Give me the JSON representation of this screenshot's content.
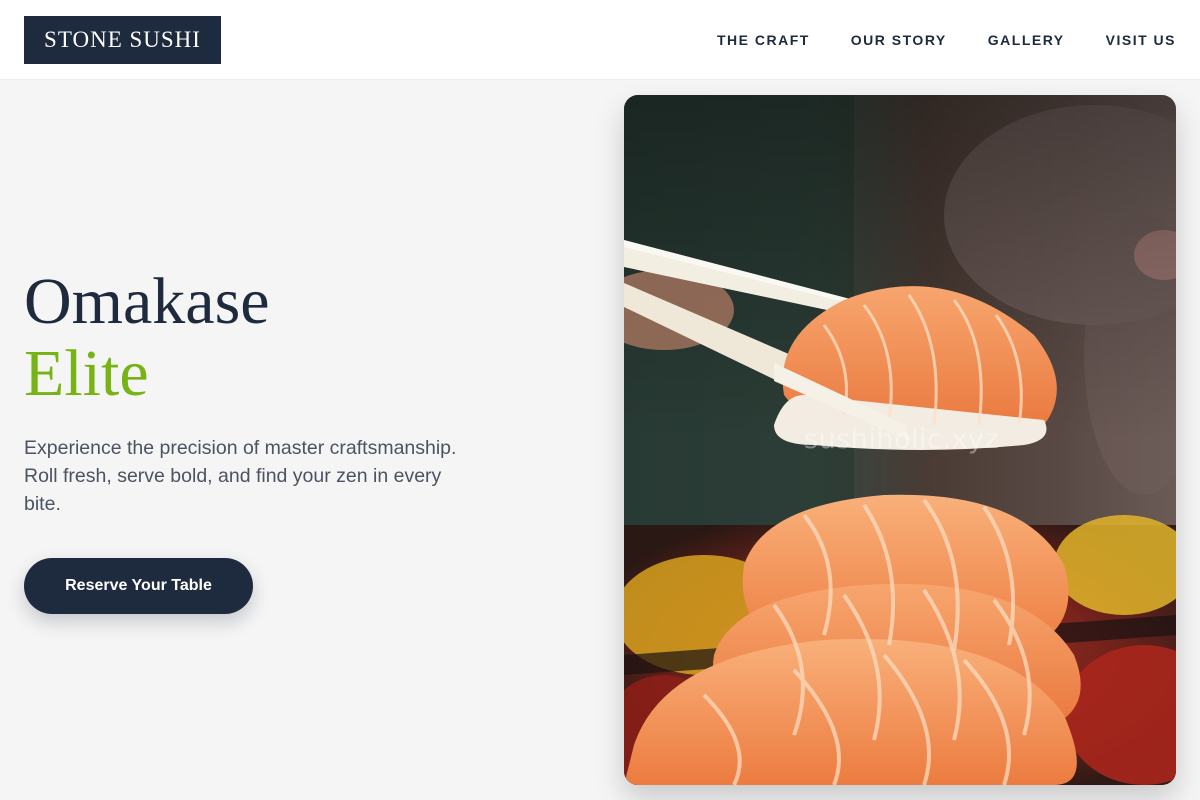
{
  "brand": {
    "name": "STONE SUSHI"
  },
  "nav": {
    "items": [
      {
        "label": "THE CRAFT"
      },
      {
        "label": "OUR STORY"
      },
      {
        "label": "GALLERY"
      },
      {
        "label": "VISIT US"
      }
    ]
  },
  "hero": {
    "title_line1": "Omakase",
    "title_line2": "Elite",
    "description": "Experience the precision of master craftsmanship. Roll fresh, serve bold, and find your zen in every bite.",
    "cta_label": "Reserve Your Table"
  },
  "image": {
    "subject": "salmon nigiri held by chopsticks above a platter of salmon sushi",
    "watermark": "sushiholic.xyz"
  },
  "colors": {
    "navy": "#1e2a3e",
    "accent_green": "#77b314",
    "background": "#f5f5f5",
    "body_text": "#4b5362",
    "salmon": "#f08a4b"
  }
}
